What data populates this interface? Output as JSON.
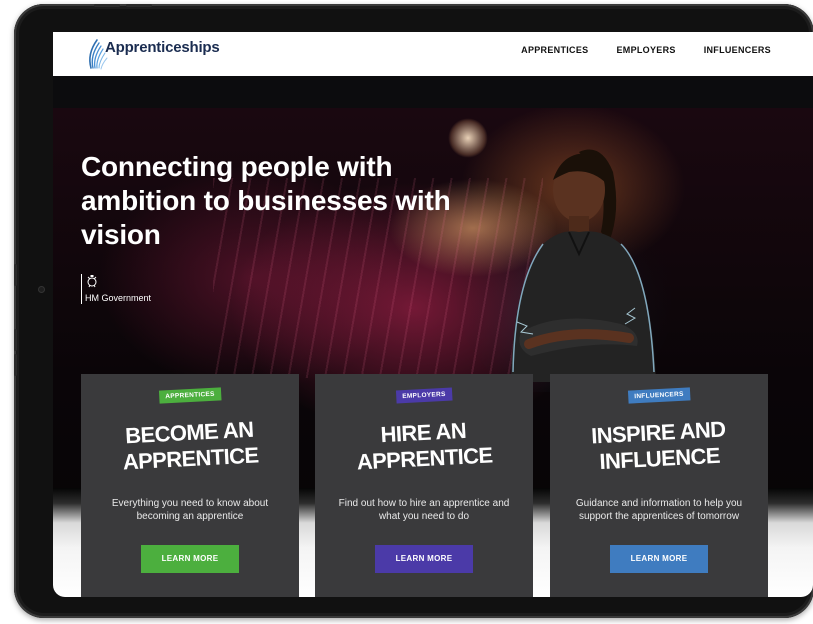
{
  "nav": {
    "brand": "Apprenticeships",
    "links": [
      "APPRENTICES",
      "EMPLOYERS",
      "INFLUENCERS"
    ]
  },
  "hero": {
    "headline": "Connecting people with ambition to businesses with vision",
    "gov_label": "HM Government"
  },
  "cards": [
    {
      "tag": "APPRENTICES",
      "title_line1": "BECOME AN",
      "title_line2": "APPRENTICE",
      "desc": "Everything you need to know about becoming an apprentice",
      "button": "LEARN MORE",
      "color": "#4caf3e"
    },
    {
      "tag": "EMPLOYERS",
      "title_line1": "HIRE AN",
      "title_line2": "APPRENTICE",
      "desc": "Find out how to hire an apprentice and what you need to do",
      "button": "LEARN MORE",
      "color": "#4b3aa8"
    },
    {
      "tag": "INFLUENCERS",
      "title_line1": "INSPIRE AND",
      "title_line2": "INFLUENCE",
      "desc": "Guidance and information to help you support the apprentices of tomorrow",
      "button": "LEARN MORE",
      "color": "#3f7cc0"
    }
  ],
  "colors": {
    "brand_navy": "#1a2c50",
    "card_bg": "#3a3a3c"
  },
  "icons": [
    "apprenticeships-logo-icon",
    "hm-government-crest-icon"
  ]
}
